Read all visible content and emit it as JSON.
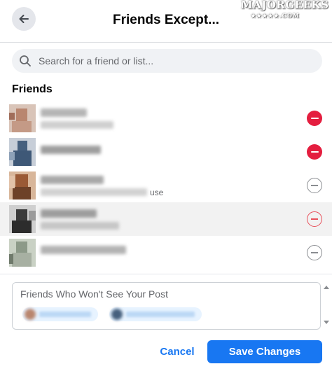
{
  "header": {
    "title": "Friends Except...",
    "back_icon": "arrow-left-icon",
    "watermark_text": "MAJORGEEKS",
    "watermark_stars": "★★★★★.COM"
  },
  "search": {
    "placeholder": "Search for a friend or list...",
    "icon": "search-icon"
  },
  "friends": {
    "label": "Friends",
    "rows": [
      {
        "state": "excluded",
        "sub_suffix": "",
        "avatar_color": "#b9866f"
      },
      {
        "state": "excluded",
        "sub_suffix": "",
        "avatar_color": "#46607e"
      },
      {
        "state": "included",
        "sub_suffix": "use",
        "avatar_color": "#9a5a36"
      },
      {
        "state": "included",
        "sub_suffix": "",
        "avatar_color": "#3a3a3a"
      },
      {
        "state": "included",
        "sub_suffix": "",
        "avatar_color": "#8c9988"
      }
    ]
  },
  "excluded_box": {
    "label": "Friends Who Won't See Your Post"
  },
  "footer": {
    "cancel_label": "Cancel",
    "save_label": "Save Changes"
  },
  "colors": {
    "accent": "#1877f2",
    "remove_red": "#e41e3f",
    "muted": "#65676b"
  }
}
